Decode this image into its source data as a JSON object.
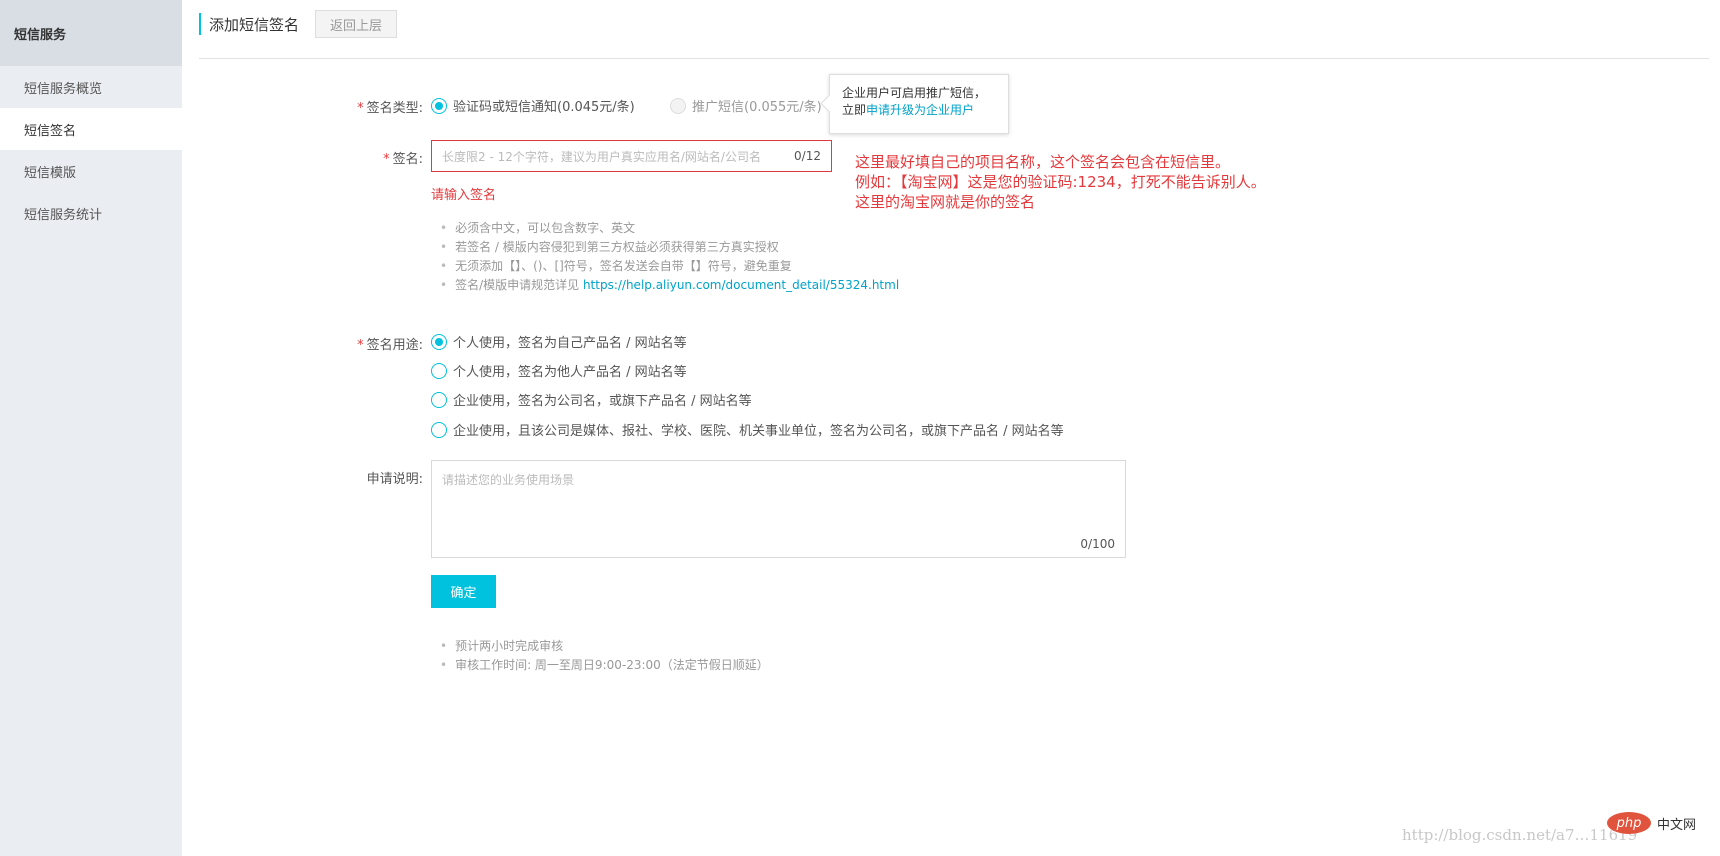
{
  "sidebar": {
    "title": "短信服务",
    "items": [
      {
        "label": "短信服务概览",
        "active": false
      },
      {
        "label": "短信签名",
        "active": true
      },
      {
        "label": "短信模版",
        "active": false
      },
      {
        "label": "短信服务统计",
        "active": false
      }
    ]
  },
  "header": {
    "title": "添加短信签名",
    "back_label": "返回上层"
  },
  "form": {
    "sign_type": {
      "label": "签名类型:",
      "options": [
        {
          "label": "验证码或短信通知(0.045元/条)",
          "checked": true,
          "disabled": false
        },
        {
          "label": "推广短信(0.055元/条)",
          "checked": false,
          "disabled": true
        }
      ]
    },
    "tooltip": {
      "line1": "企业用户可启用推广短信，",
      "line2_prefix": "立即",
      "line2_link": "申请升级为企业用户"
    },
    "sign": {
      "label": "签名:",
      "placeholder": "长度限2 - 12个字符，建议为用户真实应用名/网站名/公司名",
      "count": "0/12",
      "error": "请输入签名"
    },
    "sign_hints": [
      "必须含中文，可以包含数字、英文",
      "若签名 / 模版内容侵犯到第三方权益必须获得第三方真实授权",
      "无须添加【】、()、[]符号，签名发送会自带【】符号，避免重复"
    ],
    "sign_hint_link_prefix": "签名/模版申请规范详见 ",
    "sign_hint_link": "https://help.aliyun.com/document_detail/55324.html",
    "usage": {
      "label": "签名用途:",
      "options": [
        {
          "label": "个人使用，签名为自己产品名 / 网站名等",
          "checked": true
        },
        {
          "label": "个人使用，签名为他人产品名 / 网站名等",
          "checked": false
        },
        {
          "label": "企业使用，签名为公司名，或旗下产品名 / 网站名等",
          "checked": false
        },
        {
          "label": "企业使用，且该公司是媒体、报社、学校、医院、机关事业单位，签名为公司名，或旗下产品名 / 网站名等",
          "checked": false
        }
      ]
    },
    "description": {
      "label": "申请说明:",
      "placeholder": "请描述您的业务使用场景",
      "count": "0/100"
    },
    "submit_label": "确定",
    "footer_hints": [
      "预计两小时完成审核",
      "审核工作时间: 周一至周日9:00-23:00（法定节假日顺延）"
    ]
  },
  "annotation": [
    "这里最好填自己的项目名称，这个签名会包含在短信里。",
    "例如：【淘宝网】这是您的验证码:1234，打死不能告诉别人。",
    "这里的淘宝网就是你的签名"
  ],
  "watermark": "http://blog.csdn.net/a7…11619",
  "logo": {
    "badge": "php",
    "text": "中文网"
  },
  "colors": {
    "accent": "#00c1de",
    "error": "#e4393c",
    "link": "#00a2ca"
  }
}
